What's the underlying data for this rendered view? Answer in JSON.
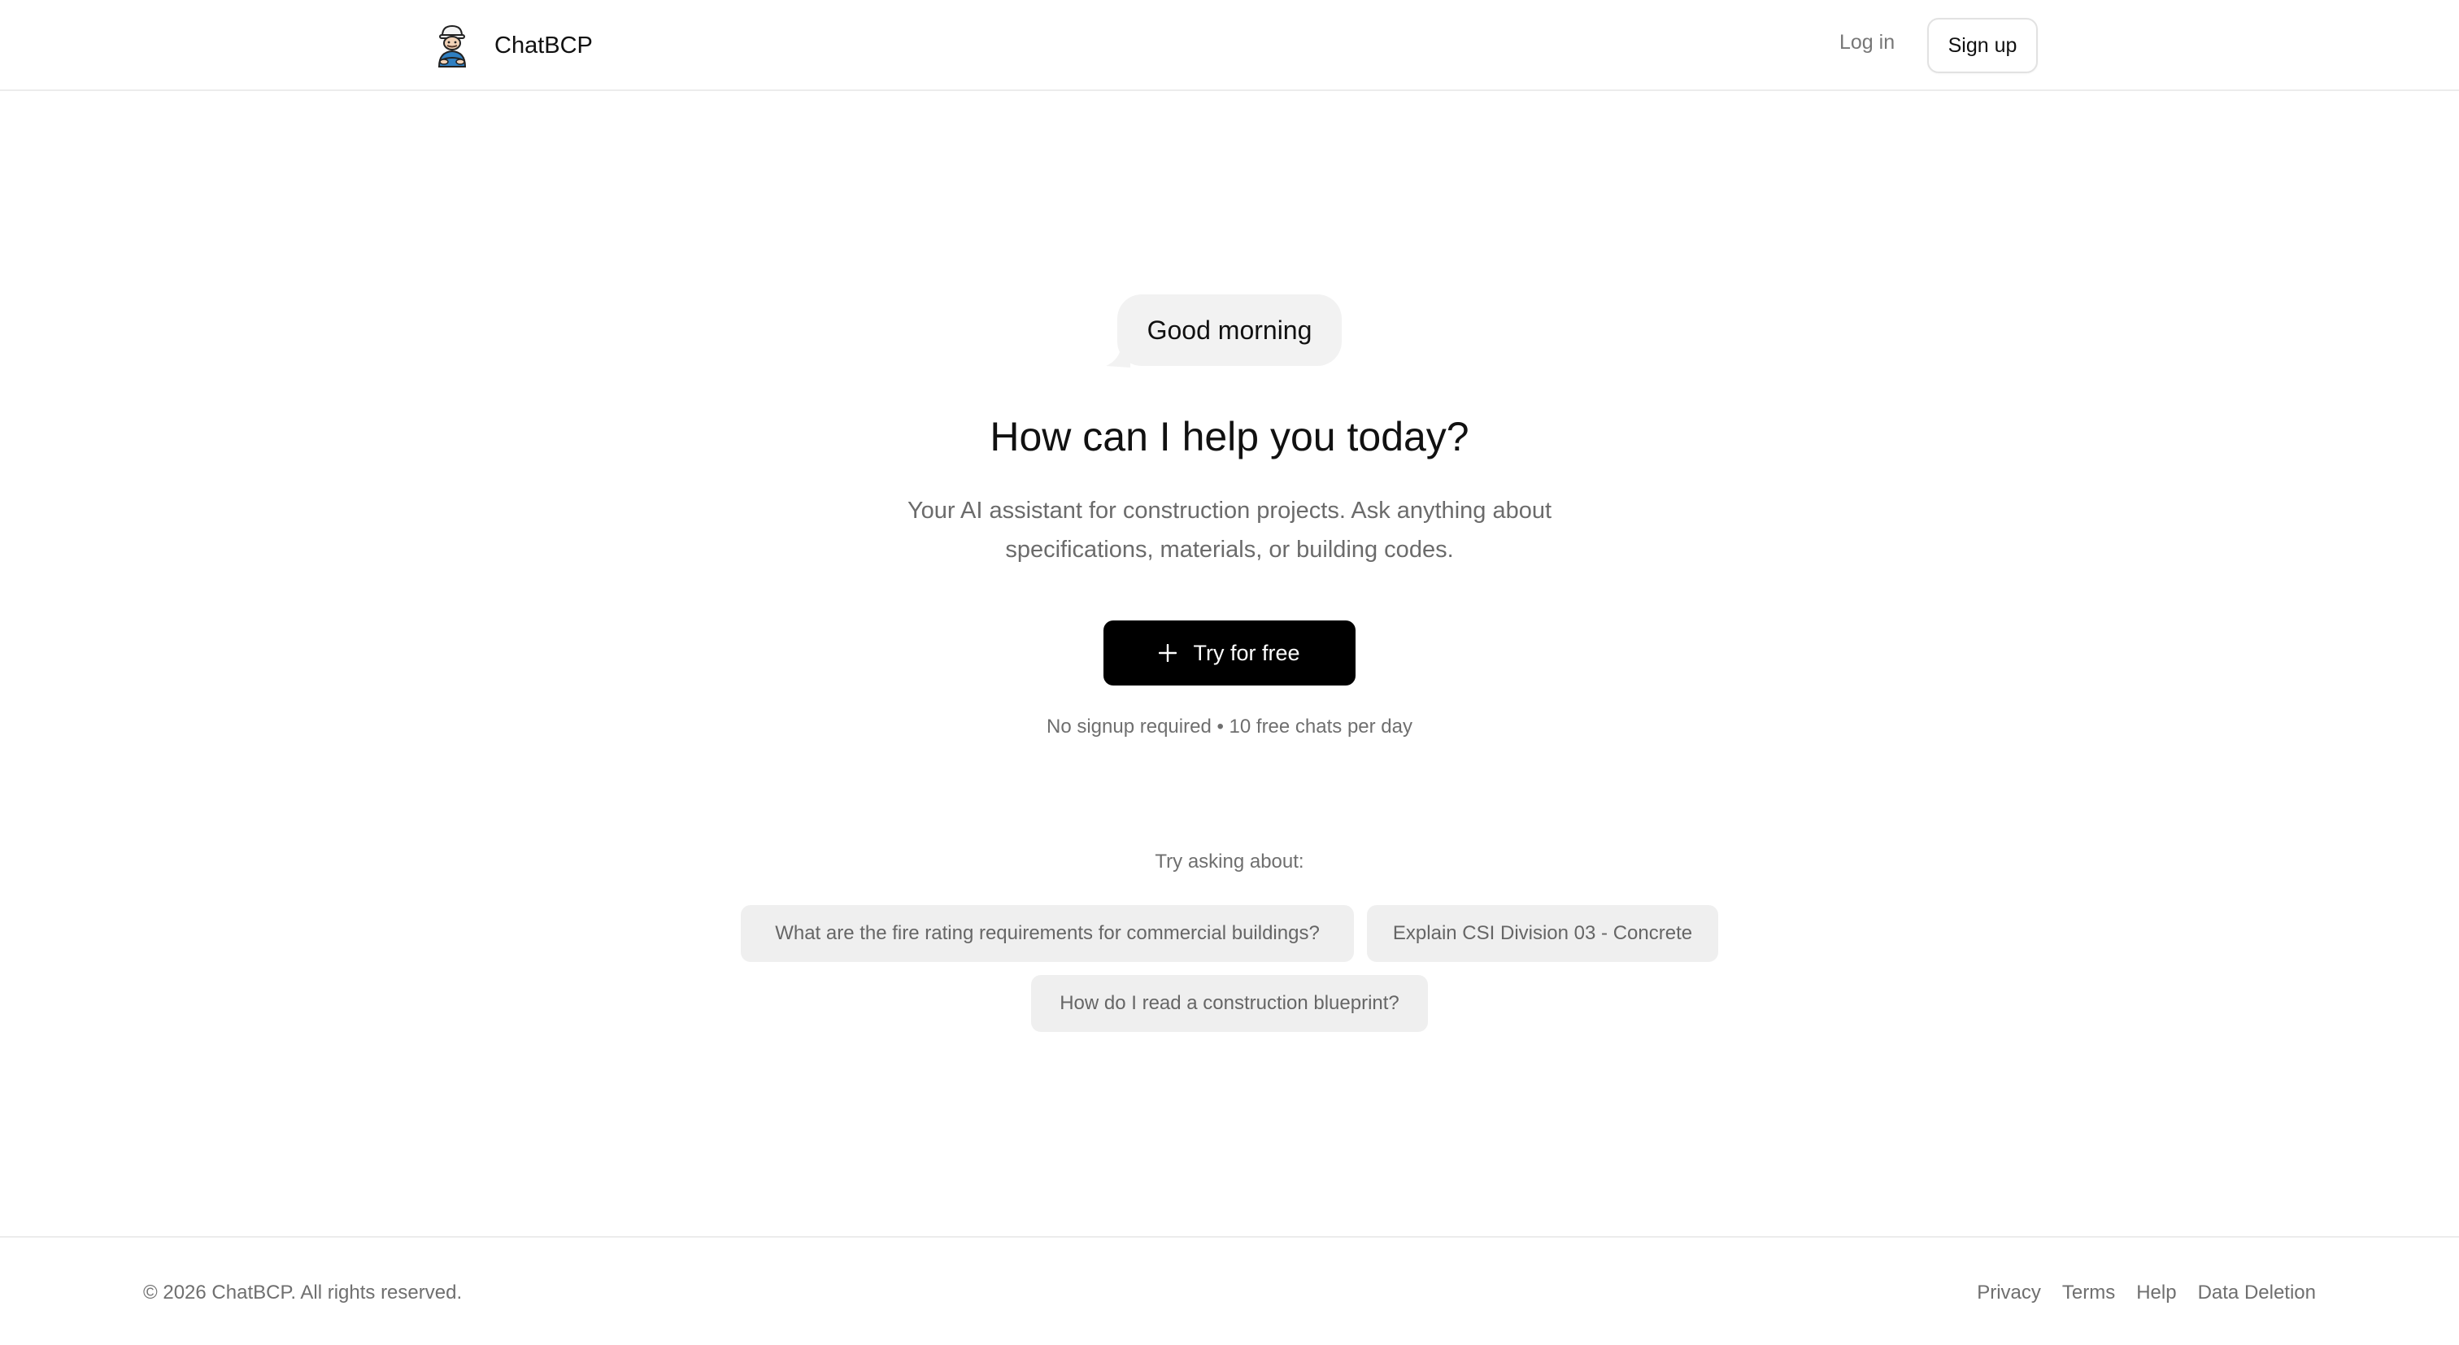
{
  "header": {
    "brand_name": "ChatBCP",
    "login_label": "Log in",
    "signup_label": "Sign up"
  },
  "hero": {
    "greeting": "Good morning",
    "headline": "How can I help you today?",
    "subtitle_line1": "Your AI assistant for construction projects. Ask anything about",
    "subtitle_line2": "specifications, materials, or building codes.",
    "cta_label": "Try for free",
    "cta_icon": "plus-icon",
    "note": "No signup required • 10 free chats per day"
  },
  "suggestions": {
    "heading": "Try asking about:",
    "items": [
      "What are the fire rating requirements for commercial buildings?",
      "Explain CSI Division 03 - Concrete",
      "How do I read a construction blueprint?"
    ]
  },
  "footer": {
    "copyright": "© 2026 ChatBCP. All rights reserved.",
    "links": [
      "Privacy",
      "Terms",
      "Help",
      "Data Deletion"
    ]
  },
  "colors": {
    "primary_button": "#000000",
    "bubble_bg": "#f2f2f2",
    "chip_bg": "#efefef",
    "muted_text": "#6f6f6f"
  }
}
